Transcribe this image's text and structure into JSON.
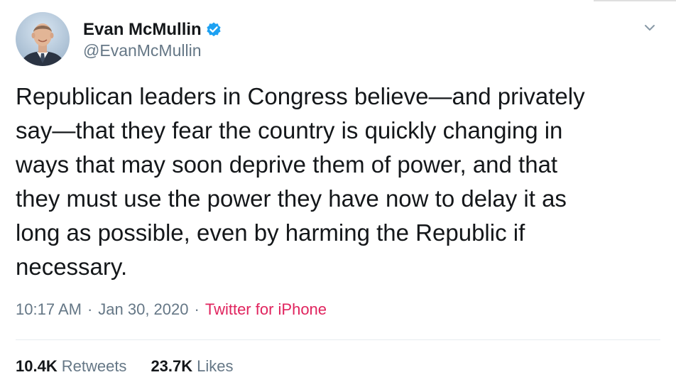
{
  "tweet": {
    "author": {
      "display_name": "Evan McMullin",
      "handle": "@EvanMcMullin",
      "verified": true
    },
    "text": "Republican leaders in Congress believe—and privately\nsay—that they fear the country is quickly changing in\nways that may soon deprive them of power, and that\nthey must use the power they have now to delay it as\nlong as possible, even by harming the Republic if\nnecessary.",
    "time": "10:17 AM",
    "date": "Jan 30, 2020",
    "separator": "·",
    "source": "Twitter for iPhone",
    "stats": {
      "retweets_count": "10.4K",
      "retweets_label": "Retweets",
      "likes_count": "23.7K",
      "likes_label": "Likes"
    }
  },
  "icons": {
    "verified": "verified-badge-icon",
    "menu": "chevron-down-icon"
  },
  "colors": {
    "text_primary": "#14171a",
    "text_secondary": "#657786",
    "verified_blue": "#1da1f2",
    "source_link": "#e0245e",
    "divider": "#e6ecf0"
  }
}
